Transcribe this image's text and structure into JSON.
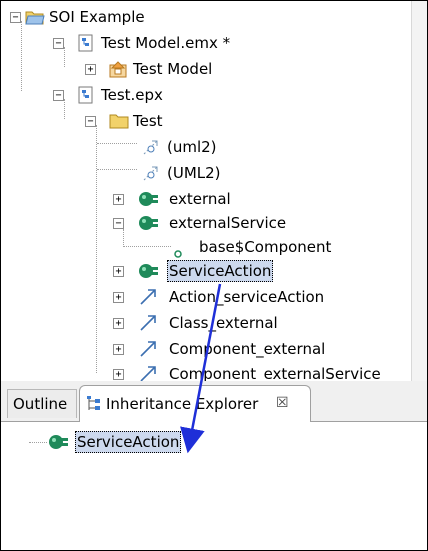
{
  "tree": {
    "items": [
      {
        "label": "SOI Example",
        "icon": "project-folder-icon"
      },
      {
        "label": "Test Model.emx *",
        "icon": "model-file-icon"
      },
      {
        "label": "Test Model",
        "icon": "model-package-icon"
      },
      {
        "label": "Test.epx",
        "icon": "model-file-icon"
      },
      {
        "label": "Test",
        "icon": "folder-icon"
      },
      {
        "label": "(uml2)",
        "icon": "profile-link-icon"
      },
      {
        "label": "(UML2)",
        "icon": "profile-link-icon"
      },
      {
        "label": "external",
        "icon": "component-icon"
      },
      {
        "label": "externalService",
        "icon": "component-icon"
      },
      {
        "label": "base$Component",
        "icon": "attribute-icon"
      },
      {
        "label": "ServiceAction",
        "icon": "component-icon"
      },
      {
        "label": "Action_serviceAction",
        "icon": "dependency-arrow-icon"
      },
      {
        "label": "Class_external",
        "icon": "dependency-arrow-icon"
      },
      {
        "label": "Component_external",
        "icon": "dependency-arrow-icon"
      },
      {
        "label": "Component_externalService",
        "icon": "dependency-arrow-icon"
      }
    ]
  },
  "tabs": {
    "outline": "Outline",
    "inheritance": "Inheritance Explorer",
    "close_glyph": "☒"
  },
  "inheritance_tree": {
    "root_label": "ServiceAction"
  },
  "toggles": {
    "expanded": "−",
    "collapsed": "+"
  },
  "colors": {
    "arrow": "#1f2fd8",
    "selection": "#cdd9ee",
    "folder": "#f2d26a",
    "component": "#1f8a5a"
  }
}
